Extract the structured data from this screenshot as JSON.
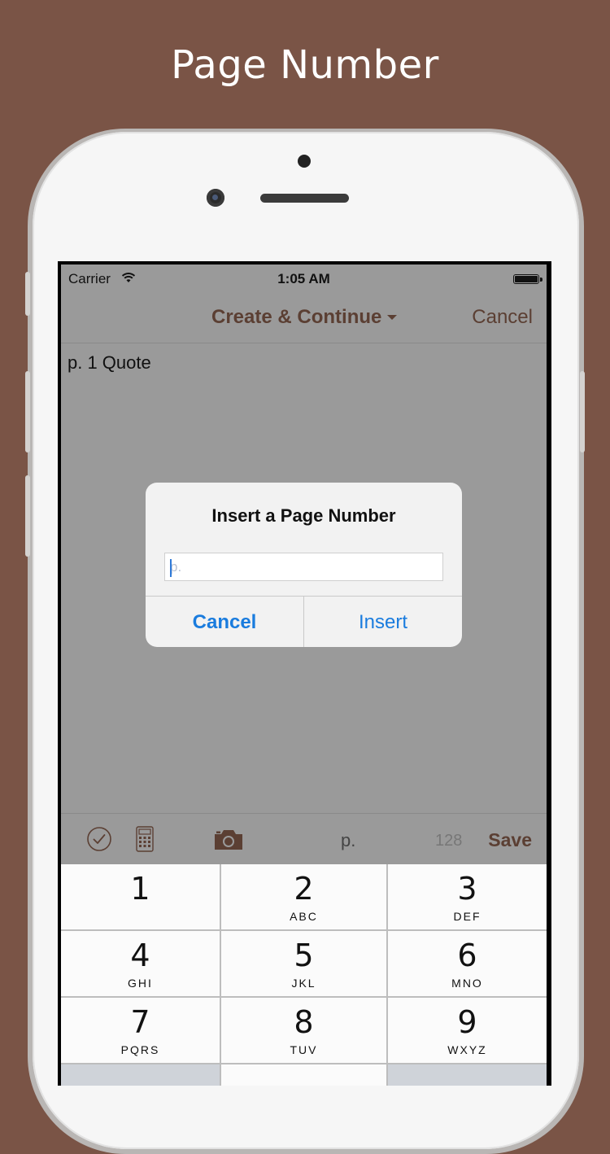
{
  "headline": "Page Number",
  "colors": {
    "background": "#7a5446",
    "accent": "#5b3f33",
    "alert_button": "#1a7cde"
  },
  "status_bar": {
    "carrier": "Carrier",
    "time": "1:05 AM"
  },
  "navbar": {
    "title": "Create & Continue",
    "cancel": "Cancel"
  },
  "content": {
    "text": "p. 1 Quote"
  },
  "alert": {
    "title": "Insert a Page Number",
    "input_placeholder": "p.",
    "input_value": "",
    "cancel_label": "Cancel",
    "insert_label": "Insert"
  },
  "toolbar": {
    "icons": [
      "checkmark-circle-icon",
      "calculator-icon",
      "camera-icon"
    ],
    "page_prefix": "p.",
    "char_count": "128",
    "save_label": "Save"
  },
  "keypad": {
    "keys": [
      {
        "num": "1",
        "letters": ""
      },
      {
        "num": "2",
        "letters": "ABC"
      },
      {
        "num": "3",
        "letters": "DEF"
      },
      {
        "num": "4",
        "letters": "GHI"
      },
      {
        "num": "5",
        "letters": "JKL"
      },
      {
        "num": "6",
        "letters": "MNO"
      },
      {
        "num": "7",
        "letters": "PQRS"
      },
      {
        "num": "8",
        "letters": "TUV"
      },
      {
        "num": "9",
        "letters": "WXYZ"
      }
    ]
  }
}
